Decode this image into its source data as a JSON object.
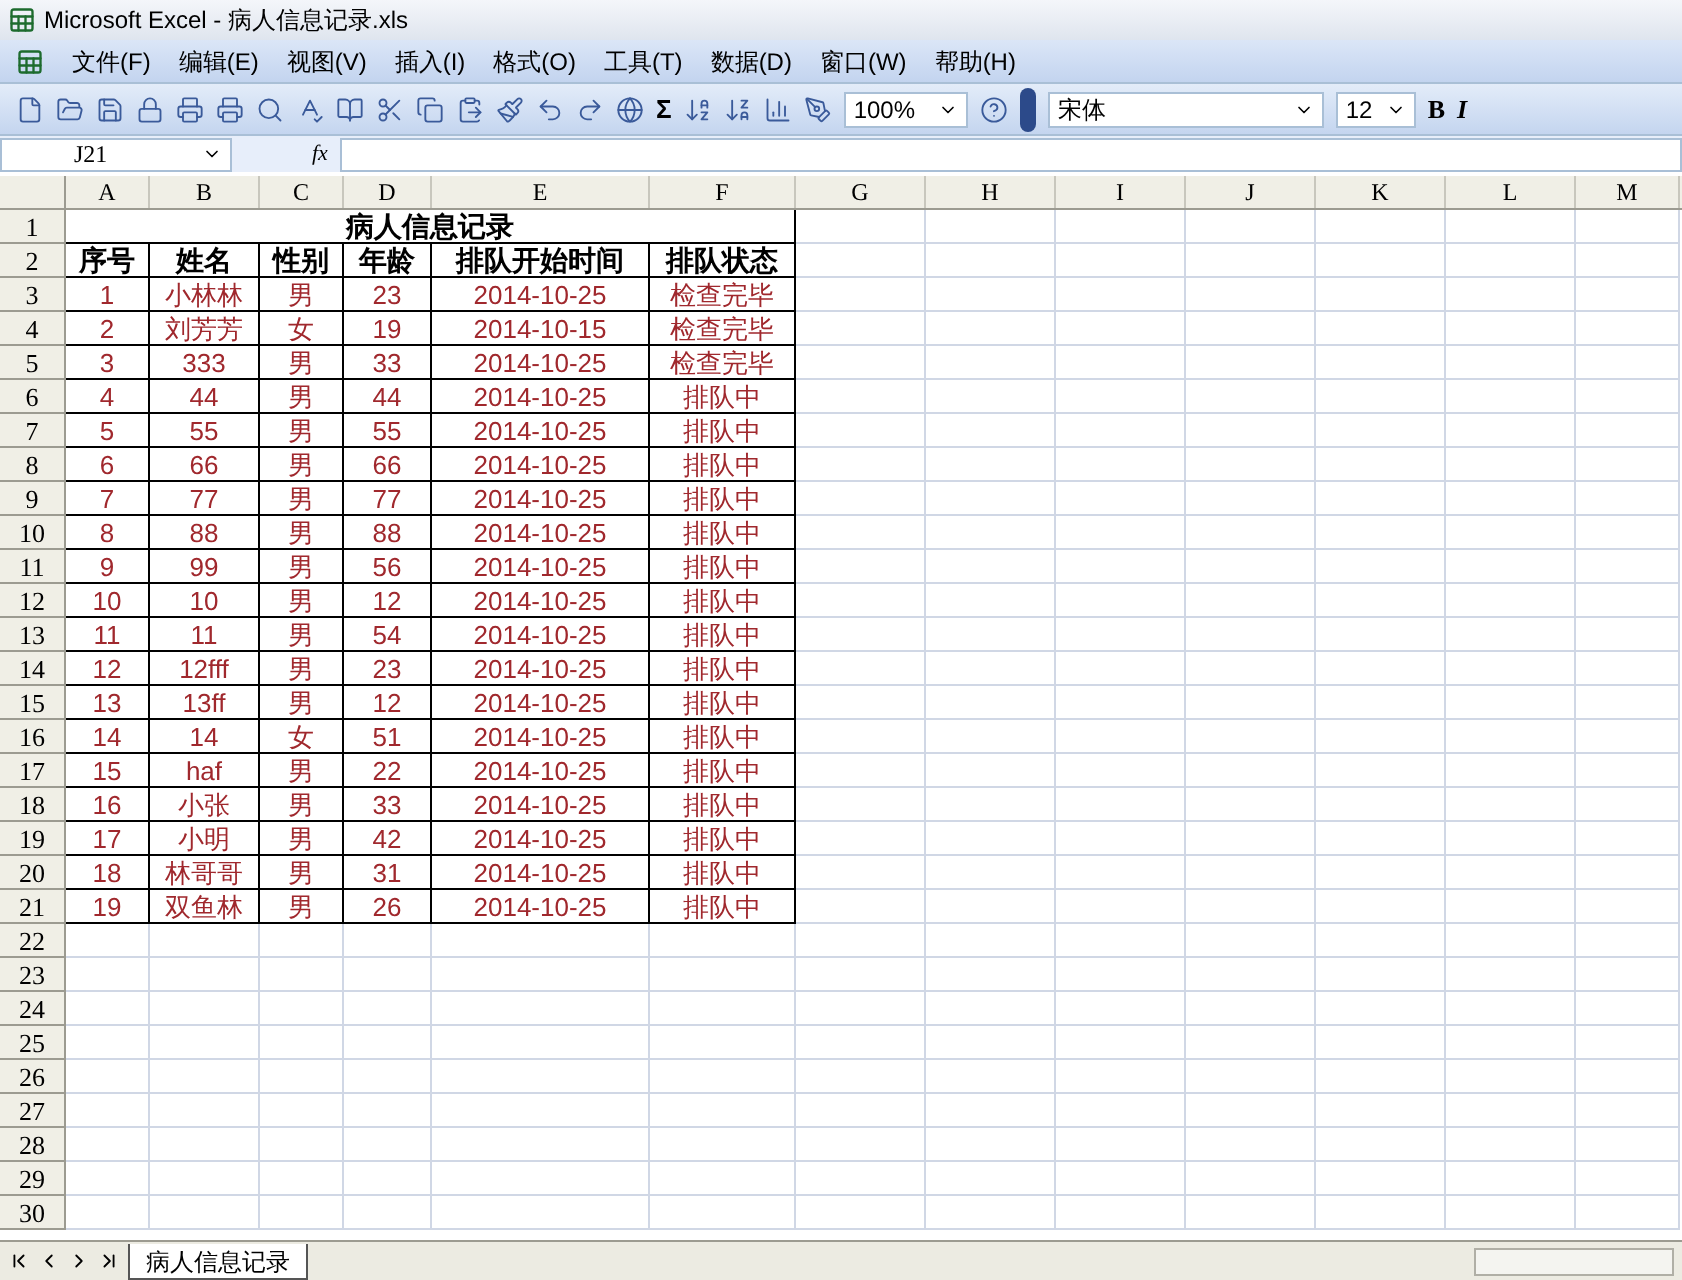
{
  "window": {
    "title": "Microsoft Excel - 病人信息记录.xls"
  },
  "menu": [
    {
      "label": "文件(F)"
    },
    {
      "label": "编辑(E)"
    },
    {
      "label": "视图(V)"
    },
    {
      "label": "插入(I)"
    },
    {
      "label": "格式(O)"
    },
    {
      "label": "工具(T)"
    },
    {
      "label": "数据(D)"
    },
    {
      "label": "窗口(W)"
    },
    {
      "label": "帮助(H)"
    }
  ],
  "toolbar": {
    "sum": "Σ",
    "zoom": "100%",
    "font": "宋体",
    "font_size": "12",
    "bold": "B",
    "italic": "I"
  },
  "formula_bar": {
    "name_box": "J21",
    "fx": "fx"
  },
  "columns": [
    "A",
    "B",
    "C",
    "D",
    "E",
    "F",
    "G",
    "H",
    "I",
    "J",
    "K",
    "L",
    "M"
  ],
  "row_numbers": [
    "1",
    "2",
    "3",
    "4",
    "5",
    "6",
    "7",
    "8",
    "9",
    "10",
    "11",
    "12",
    "13",
    "14",
    "15",
    "16",
    "17",
    "18",
    "19",
    "20",
    "21",
    "22",
    "23",
    "24",
    "25",
    "26",
    "27",
    "28",
    "29",
    "30"
  ],
  "table": {
    "title": "病人信息记录",
    "headers": [
      "序号",
      "姓名",
      "性别",
      "年龄",
      "排队开始时间",
      "排队状态"
    ],
    "rows": [
      [
        "1",
        "小林林",
        "男",
        "23",
        "2014-10-25",
        "检查完毕"
      ],
      [
        "2",
        "刘芳芳",
        "女",
        "19",
        "2014-10-15",
        "检查完毕"
      ],
      [
        "3",
        "333",
        "男",
        "33",
        "2014-10-25",
        "检查完毕"
      ],
      [
        "4",
        "44",
        "男",
        "44",
        "2014-10-25",
        "排队中"
      ],
      [
        "5",
        "55",
        "男",
        "55",
        "2014-10-25",
        "排队中"
      ],
      [
        "6",
        "66",
        "男",
        "66",
        "2014-10-25",
        "排队中"
      ],
      [
        "7",
        "77",
        "男",
        "77",
        "2014-10-25",
        "排队中"
      ],
      [
        "8",
        "88",
        "男",
        "88",
        "2014-10-25",
        "排队中"
      ],
      [
        "9",
        "99",
        "男",
        "56",
        "2014-10-25",
        "排队中"
      ],
      [
        "10",
        "10",
        "男",
        "12",
        "2014-10-25",
        "排队中"
      ],
      [
        "11",
        "11",
        "男",
        "54",
        "2014-10-25",
        "排队中"
      ],
      [
        "12",
        "12fff",
        "男",
        "23",
        "2014-10-25",
        "排队中"
      ],
      [
        "13",
        "13ff",
        "男",
        "12",
        "2014-10-25",
        "排队中"
      ],
      [
        "14",
        "14",
        "女",
        "51",
        "2014-10-25",
        "排队中"
      ],
      [
        "15",
        "haf",
        "男",
        "22",
        "2014-10-25",
        "排队中"
      ],
      [
        "16",
        "小张",
        "男",
        "33",
        "2014-10-25",
        "排队中"
      ],
      [
        "17",
        "小明",
        "男",
        "42",
        "2014-10-25",
        "排队中"
      ],
      [
        "18",
        "林哥哥",
        "男",
        "31",
        "2014-10-25",
        "排队中"
      ],
      [
        "19",
        "双鱼林",
        "男",
        "26",
        "2014-10-25",
        "排队中"
      ]
    ]
  },
  "sheet_tabs": [
    {
      "label": "病人信息记录",
      "selected": true
    }
  ]
}
